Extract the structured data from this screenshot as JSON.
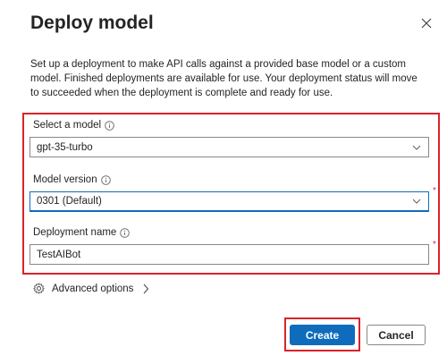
{
  "dialog": {
    "title": "Deploy model",
    "description": "Set up a deployment to make API calls against a provided base model or a custom model. Finished deployments are available for use. Your deployment status will move to succeeded when the deployment is complete and ready for use."
  },
  "fields": {
    "model": {
      "label": "Select a model",
      "value": "gpt-35-turbo"
    },
    "version": {
      "label": "Model version",
      "value": "0301 (Default)",
      "required_mark": "*"
    },
    "deployment_name": {
      "label": "Deployment name",
      "value": "TestAIBot",
      "required_mark": "*"
    }
  },
  "advanced": {
    "label": "Advanced options"
  },
  "buttons": {
    "create": "Create",
    "cancel": "Cancel"
  },
  "colors": {
    "accent": "#0f6cbd",
    "highlight": "#d9232a",
    "required": "#c4314b"
  }
}
